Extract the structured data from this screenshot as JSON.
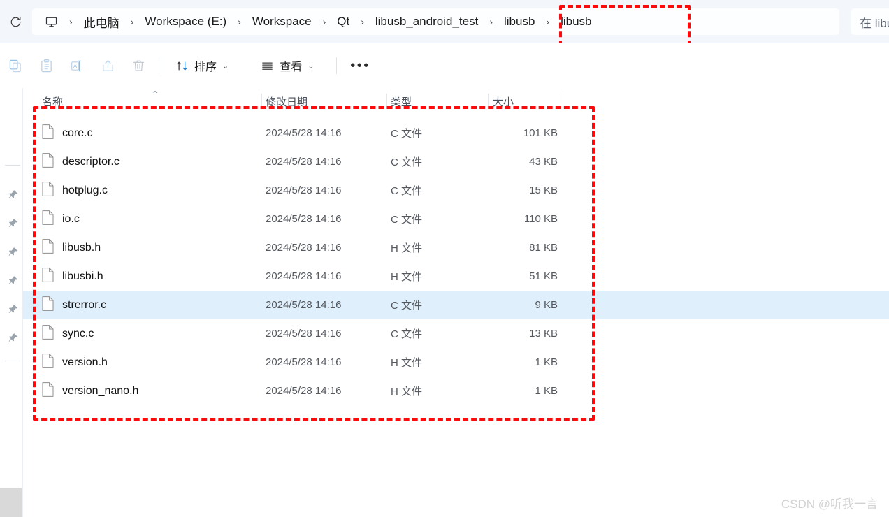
{
  "window": {
    "accent_color": "#0f6cbd",
    "highlight_color": "#fb0b0b",
    "selection_color": "#dfeffc"
  },
  "addressbar": {
    "refresh_label": "refresh-icon",
    "pc_icon_label": "this-pc-icon",
    "separator": "›",
    "crumbs": [
      {
        "label": "此电脑"
      },
      {
        "label": "Workspace (E:)"
      },
      {
        "label": "Workspace"
      },
      {
        "label": "Qt"
      },
      {
        "label": "libusb_android_test"
      },
      {
        "label": "libusb"
      },
      {
        "label": "libusb"
      }
    ],
    "highlighted_crumbs": [
      "libusb",
      "libusb"
    ],
    "search": {
      "placeholder": "在 libu",
      "value": "在 libu"
    }
  },
  "toolbar": {
    "icons": [
      {
        "name": "copy-icon"
      },
      {
        "name": "paste-icon"
      },
      {
        "name": "rename-icon"
      },
      {
        "name": "share-icon"
      },
      {
        "name": "delete-icon"
      }
    ],
    "sort_label": "排序",
    "view_label": "查看",
    "more_label": "•••",
    "caret": "⌄"
  },
  "navrail": {
    "pin_count": 6,
    "pin_icon": "pin-icon"
  },
  "filelist": {
    "columns": [
      {
        "key": "name",
        "label": "名称",
        "sorted": true,
        "sort_direction": "asc"
      },
      {
        "key": "date",
        "label": "修改日期"
      },
      {
        "key": "type",
        "label": "类型"
      },
      {
        "key": "size",
        "label": "大小"
      }
    ],
    "sort_caret": "⌃",
    "rows": [
      {
        "name": "core.c",
        "date": "2024/5/28 14:16",
        "type": "C 文件",
        "size": "101 KB",
        "selected": false
      },
      {
        "name": "descriptor.c",
        "date": "2024/5/28 14:16",
        "type": "C 文件",
        "size": "43 KB",
        "selected": false
      },
      {
        "name": "hotplug.c",
        "date": "2024/5/28 14:16",
        "type": "C 文件",
        "size": "15 KB",
        "selected": false
      },
      {
        "name": "io.c",
        "date": "2024/5/28 14:16",
        "type": "C 文件",
        "size": "110 KB",
        "selected": false
      },
      {
        "name": "libusb.h",
        "date": "2024/5/28 14:16",
        "type": "H 文件",
        "size": "81 KB",
        "selected": false
      },
      {
        "name": "libusbi.h",
        "date": "2024/5/28 14:16",
        "type": "H 文件",
        "size": "51 KB",
        "selected": false
      },
      {
        "name": "strerror.c",
        "date": "2024/5/28 14:16",
        "type": "C 文件",
        "size": "9 KB",
        "selected": true
      },
      {
        "name": "sync.c",
        "date": "2024/5/28 14:16",
        "type": "C 文件",
        "size": "13 KB",
        "selected": false
      },
      {
        "name": "version.h",
        "date": "2024/5/28 14:16",
        "type": "H 文件",
        "size": "1 KB",
        "selected": false
      },
      {
        "name": "version_nano.h",
        "date": "2024/5/28 14:16",
        "type": "H 文件",
        "size": "1 KB",
        "selected": false
      }
    ]
  },
  "watermark": {
    "text": "CSDN @听我一言"
  }
}
